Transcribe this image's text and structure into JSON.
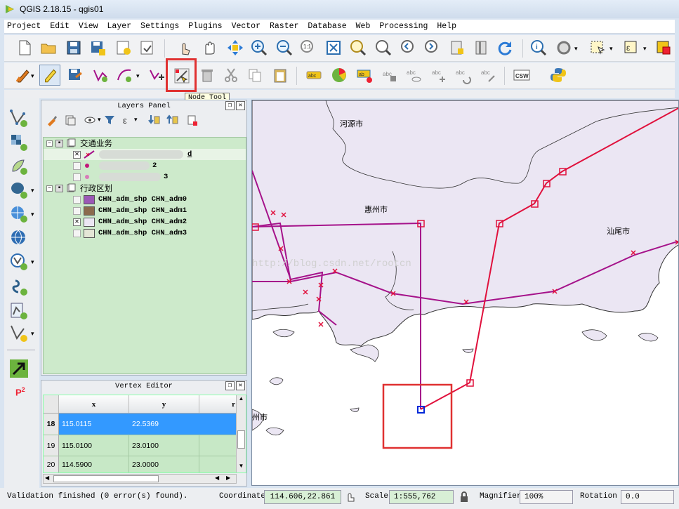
{
  "window": {
    "title": "QGIS 2.18.15 - qgis01"
  },
  "menu": [
    "Project",
    "Edit",
    "View",
    "Layer",
    "Settings",
    "Plugins",
    "Vector",
    "Raster",
    "Database",
    "Web",
    "Processing",
    "Help"
  ],
  "tooltip": {
    "node_tool": "Node Tool"
  },
  "layers_panel": {
    "title": "Layers Panel",
    "groups": [
      {
        "name": "交通业务",
        "checked": true,
        "layers": [
          {
            "name": "d",
            "checked": true,
            "type": "line"
          },
          {
            "name": "2",
            "checked": false,
            "type": "point"
          },
          {
            "name": "3",
            "checked": false,
            "type": "point"
          }
        ]
      },
      {
        "name": "行政区划",
        "checked": true,
        "layers": [
          {
            "name": "CHN_adm_shp CHN_adm0",
            "checked": false,
            "color": "#9b59b6"
          },
          {
            "name": "CHN_adm_shp CHN_adm1",
            "checked": false,
            "color": "#8b6a4d"
          },
          {
            "name": "CHN_adm_shp CHN_adm2",
            "checked": true,
            "color": "#ebe6f3"
          },
          {
            "name": "CHN_adm_shp CHN_adm3",
            "checked": false,
            "color": "#e4e6d6"
          }
        ]
      }
    ]
  },
  "vertex_editor": {
    "title": "Vertex Editor",
    "columns": [
      "x",
      "y",
      "r"
    ],
    "rows": [
      {
        "id": "18",
        "x": "115.0115",
        "y": "22.5369",
        "selected": true
      },
      {
        "id": "19",
        "x": "115.0100",
        "y": "23.0100",
        "selected": false
      },
      {
        "id": "20",
        "x": "114.5900",
        "y": "23.0000",
        "selected": false
      }
    ]
  },
  "map": {
    "labels": [
      "河源市",
      "惠州市",
      "汕尾市",
      "州市"
    ],
    "watermark": "http://blog.csdn.net/rootcn"
  },
  "status": {
    "message": "Validation finished (0 error(s) found).",
    "coordinate_label": "Coordinate",
    "coordinate_value": "114.606,22.861",
    "scale_label": "Scale",
    "scale_value": "1:555,762",
    "magnifier_label": "Magnifier",
    "magnifier_value": "100%",
    "rotation_label": "Rotation",
    "rotation_value": "0.0"
  },
  "colors": {
    "selection": "#3399ff",
    "route_red": "#e0103c",
    "route_purple": "#a5128a",
    "highlight_box": "#e03131"
  }
}
